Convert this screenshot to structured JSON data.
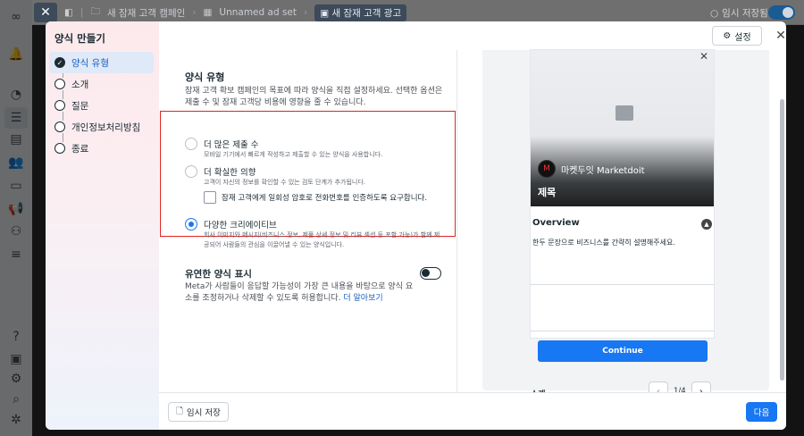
{
  "topbar": {
    "breadcrumbs": [
      {
        "label": "새 잠재 고객 캠페인",
        "icon": "folder-icon"
      },
      {
        "label": "Unnamed ad set",
        "icon": "grid-icon"
      },
      {
        "label": "새 잠재 고객 광고",
        "icon": "ad-icon"
      }
    ],
    "draft_status": "임시 저장됨"
  },
  "modal": {
    "title": "양식 만들기",
    "steps": [
      {
        "label": "양식 유형",
        "active": true
      },
      {
        "label": "소개",
        "active": false
      },
      {
        "label": "질문",
        "active": false
      },
      {
        "label": "개인정보처리방침",
        "active": false
      },
      {
        "label": "종료",
        "active": false
      }
    ],
    "settings_label": "설정",
    "form": {
      "section_title": "양식 유형",
      "section_desc": "잠재 고객 확보 캠페인의 목표에 따라 양식을 직접 설정하세요. 선택한 옵션은 제출 수 및 잠재 고객당 비용에 영향을 줄 수 있습니다.",
      "options": [
        {
          "label": "더 많은 제출 수",
          "desc": "모바일 기기에서 빠르게 작성하고 제출할 수 있는 양식을 사용합니다.",
          "checked": false
        },
        {
          "label": "더 확실한 의향",
          "desc": "고객이 자신의 정보를 확인할 수 있는 검토 단계가 추가됩니다.",
          "checked": false
        },
        {
          "label": "다양한 크리에이티브",
          "desc": "회사 이미지와 메시지(비즈니스 정보, 제품 상세 정보 및 리뷰 섹션 등 포함 가능)가 함께 제공되어 사람들의 관심을 이끌어낼 수 있는 양식입니다.",
          "checked": true
        }
      ],
      "otp_checkbox_label": "잠재 고객에게 일회성 암호로 전화번호를 인증하도록 요구합니다.",
      "rich_title": "유연한 양식 표시",
      "rich_desc": "Meta가 사람들이 응답할 가능성이 가장 큰 내용을 바탕으로 양식 요소를 조정하거나 삭제할 수 있도록 허용합니다.",
      "learn_more": "더 알아보기"
    },
    "preview": {
      "brand_name": "마켓두잇 Marketdoit",
      "brand_logo_text": "M",
      "headline": "제목",
      "overview_title": "Overview",
      "overview_text": "한두 문장으로 비즈니스를 간략히 설명해주세요.",
      "cta": "Continue",
      "section_label": "소개",
      "page_count": "1/4"
    },
    "footer": {
      "save_draft": "임시 저장",
      "next": "다음"
    }
  },
  "colors": {
    "accent": "#1877f2",
    "highlight_border": "#e02424",
    "active_step_bg": "#dfe9f8"
  }
}
